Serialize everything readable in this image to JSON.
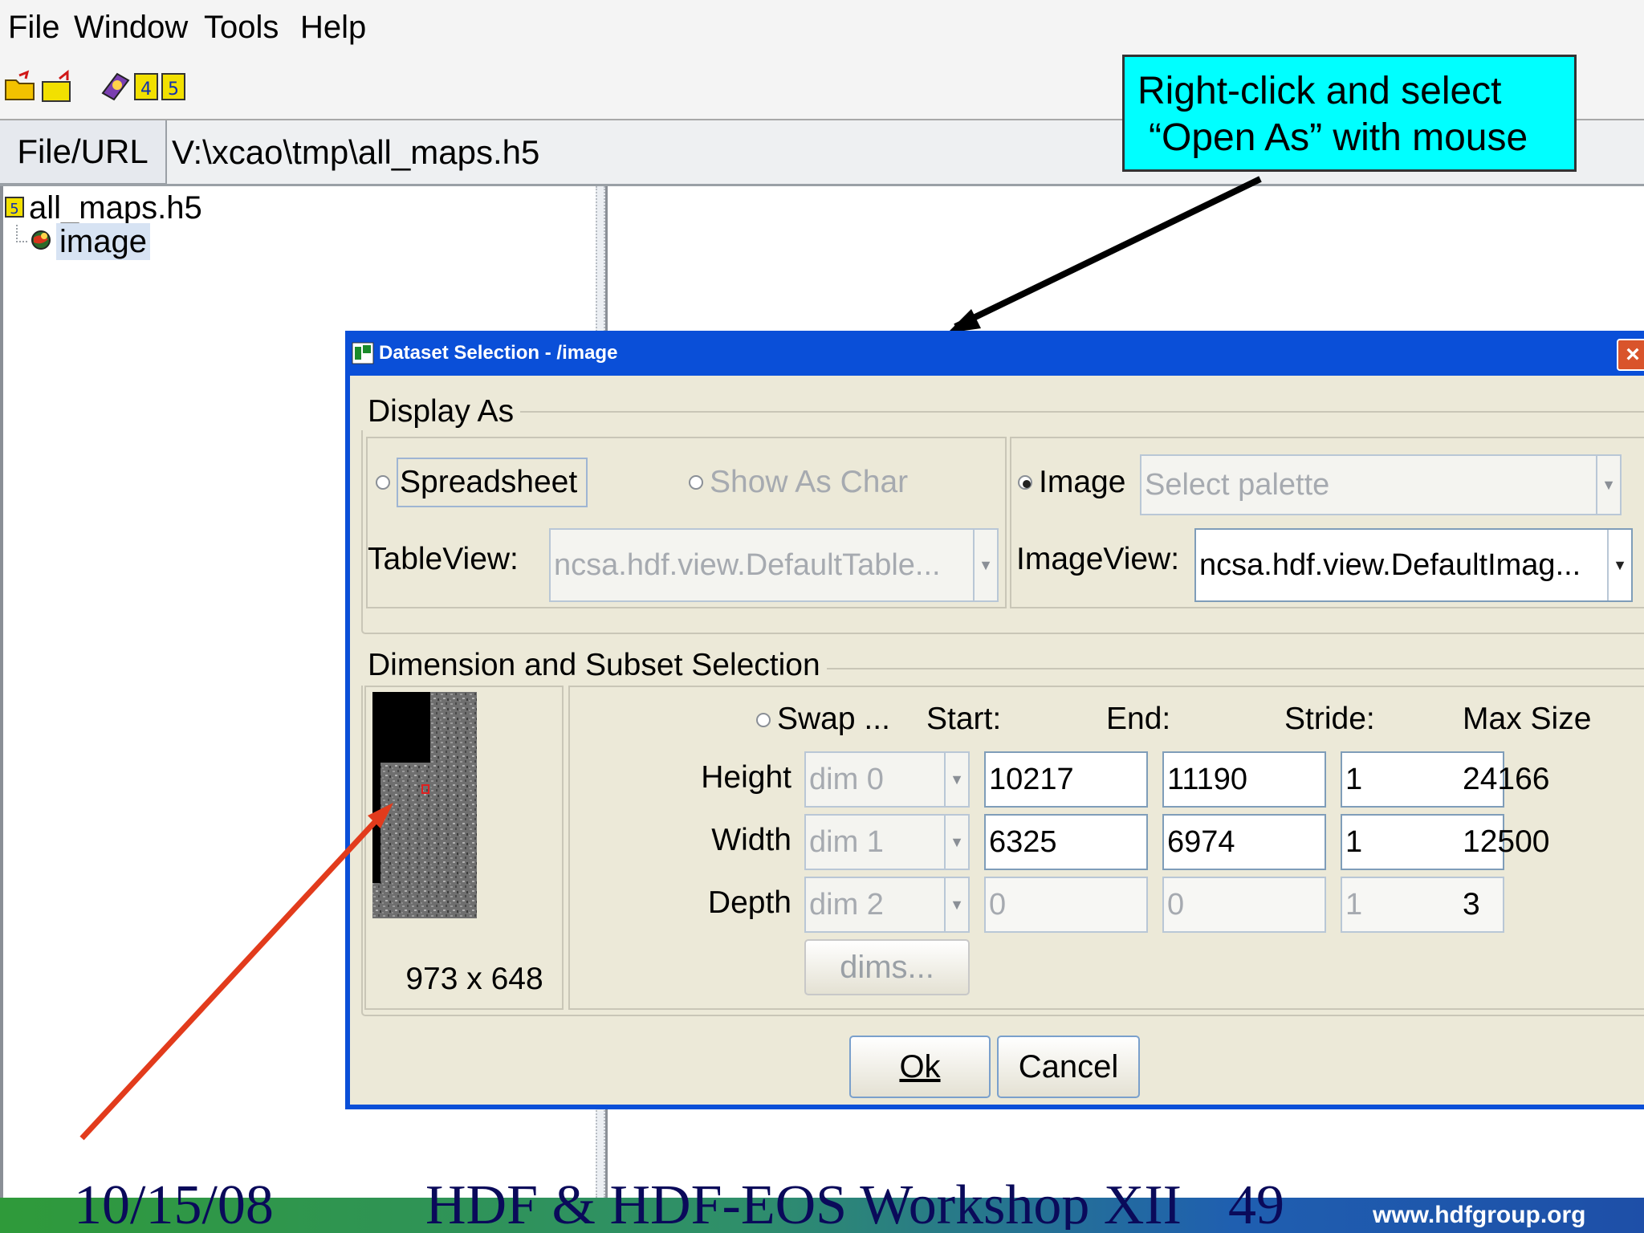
{
  "menu": {
    "items": [
      {
        "label": "File"
      },
      {
        "label": "Window"
      },
      {
        "label": "Tools"
      },
      {
        "label": "Help"
      }
    ]
  },
  "toolbar": {
    "icons": [
      "open-folder-icon",
      "close-folder-icon",
      "help-book-icon",
      "hdf4-icon",
      "hdf5-icon"
    ]
  },
  "url_bar": {
    "label": "File/URL",
    "value": "V:\\xcao\\tmp\\all_maps.h5"
  },
  "tree": {
    "root": "all_maps.h5",
    "child": "image"
  },
  "callout": {
    "line1": "Right-click and select",
    "line2": "“Open As” with mouse"
  },
  "dialog": {
    "title": "Dataset Selection - /image",
    "close_glyph": "×",
    "display_as": {
      "legend": "Display As",
      "spreadsheet": "Spreadsheet",
      "show_as_char": "Show As Char",
      "image": "Image",
      "palette_placeholder": "Select palette",
      "tableview_label": "TableView:",
      "tableview_value": "ncsa.hdf.view.DefaultTable...",
      "imageview_label": "ImageView:",
      "imageview_value": "ncsa.hdf.view.DefaultImag...",
      "selected": "image"
    },
    "dimension": {
      "legend": "Dimension and Subset Selection",
      "preview_size": "973 x 648",
      "swap": "Swap ...",
      "headers": {
        "start": "Start:",
        "end": "End:",
        "stride": "Stride:",
        "max": "Max Size"
      },
      "rows": [
        {
          "label": "Height",
          "dim": "dim 0",
          "start": "10217",
          "end": "11190",
          "stride": "1",
          "max": "24166"
        },
        {
          "label": "Width",
          "dim": "dim 1",
          "start": "6325",
          "end": "6974",
          "stride": "1",
          "max": "12500"
        },
        {
          "label": "Depth",
          "dim": "dim 2",
          "start": "0",
          "end": "0",
          "stride": "1",
          "max": "3"
        }
      ],
      "dims_button": "dims..."
    },
    "ok": "Ok",
    "cancel": "Cancel"
  },
  "footer": {
    "date": "10/15/08",
    "title": "HDF & HDF-EOS  Workshop XII",
    "page": "49",
    "url": "www.hdfgroup.org"
  },
  "colors": {
    "callout_bg": "#00ffff",
    "dialog_title": "#0a4fd8",
    "arrow_red": "#e23b1c",
    "arrow_black": "#000000"
  }
}
